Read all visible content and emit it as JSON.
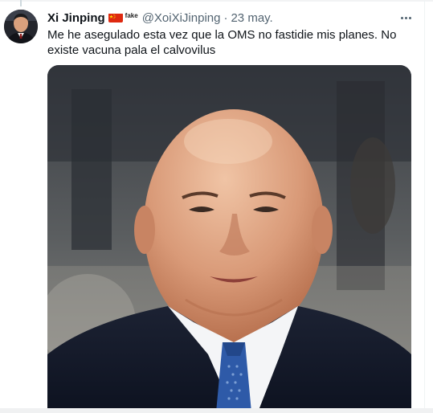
{
  "tweet": {
    "author_name": "Xi Jinping",
    "flag_icon": "china-flag-icon",
    "badge_label": "fake",
    "handle": "@XoiXiJinping",
    "separator": "·",
    "date": "23 may.",
    "more_icon": "more-options-icon",
    "text": "Me he asegulado esta vez que la OMS no fastidie mis planes. No existe vacuna pala el calvovilus"
  },
  "colors": {
    "text_primary": "#0f1419",
    "text_secondary": "#536471",
    "flag_red": "#de2910",
    "flag_yellow": "#ffde00"
  }
}
